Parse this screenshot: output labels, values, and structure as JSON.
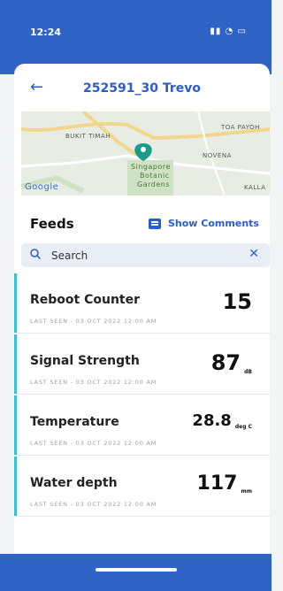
{
  "status": {
    "time": "12:24",
    "indicators": "ᵢₗ ⁝ ▪"
  },
  "header": {
    "back_icon": "arrow-left-icon",
    "title": "252591_30 Trevo"
  },
  "map": {
    "labels": [
      "BUKIT TIMAH",
      "TOA PAYOH",
      "NOVENA",
      "Singapore",
      "Botanic",
      "Gardens",
      "Google",
      "KALLA"
    ]
  },
  "feeds": {
    "title": "Feeds",
    "show_comments": "Show Comments",
    "search_placeholder": "Search",
    "items": [
      {
        "name": "Reboot Counter",
        "last_seen": "LAST SEEN - 03 OCT 2022 12:00 AM",
        "value": "15",
        "unit": ""
      },
      {
        "name": "Signal Strength",
        "last_seen": "LAST SEEN - 03 OCT 2022 12:00 AM",
        "value": "87",
        "unit": "dB"
      },
      {
        "name": "Temperature",
        "last_seen": "LAST SEEN - 03 OCT 2022 12:00 AM",
        "value": "28.8",
        "unit": "deg C"
      },
      {
        "name": "Water depth",
        "last_seen": "LAST SEEN - 03 OCT 2022 12:00 AM",
        "value": "117",
        "unit": "mm"
      }
    ]
  },
  "colors": {
    "brand": "#2f63c6",
    "accent": "#2a5bd7",
    "feed_bar": "#39c1d4"
  }
}
